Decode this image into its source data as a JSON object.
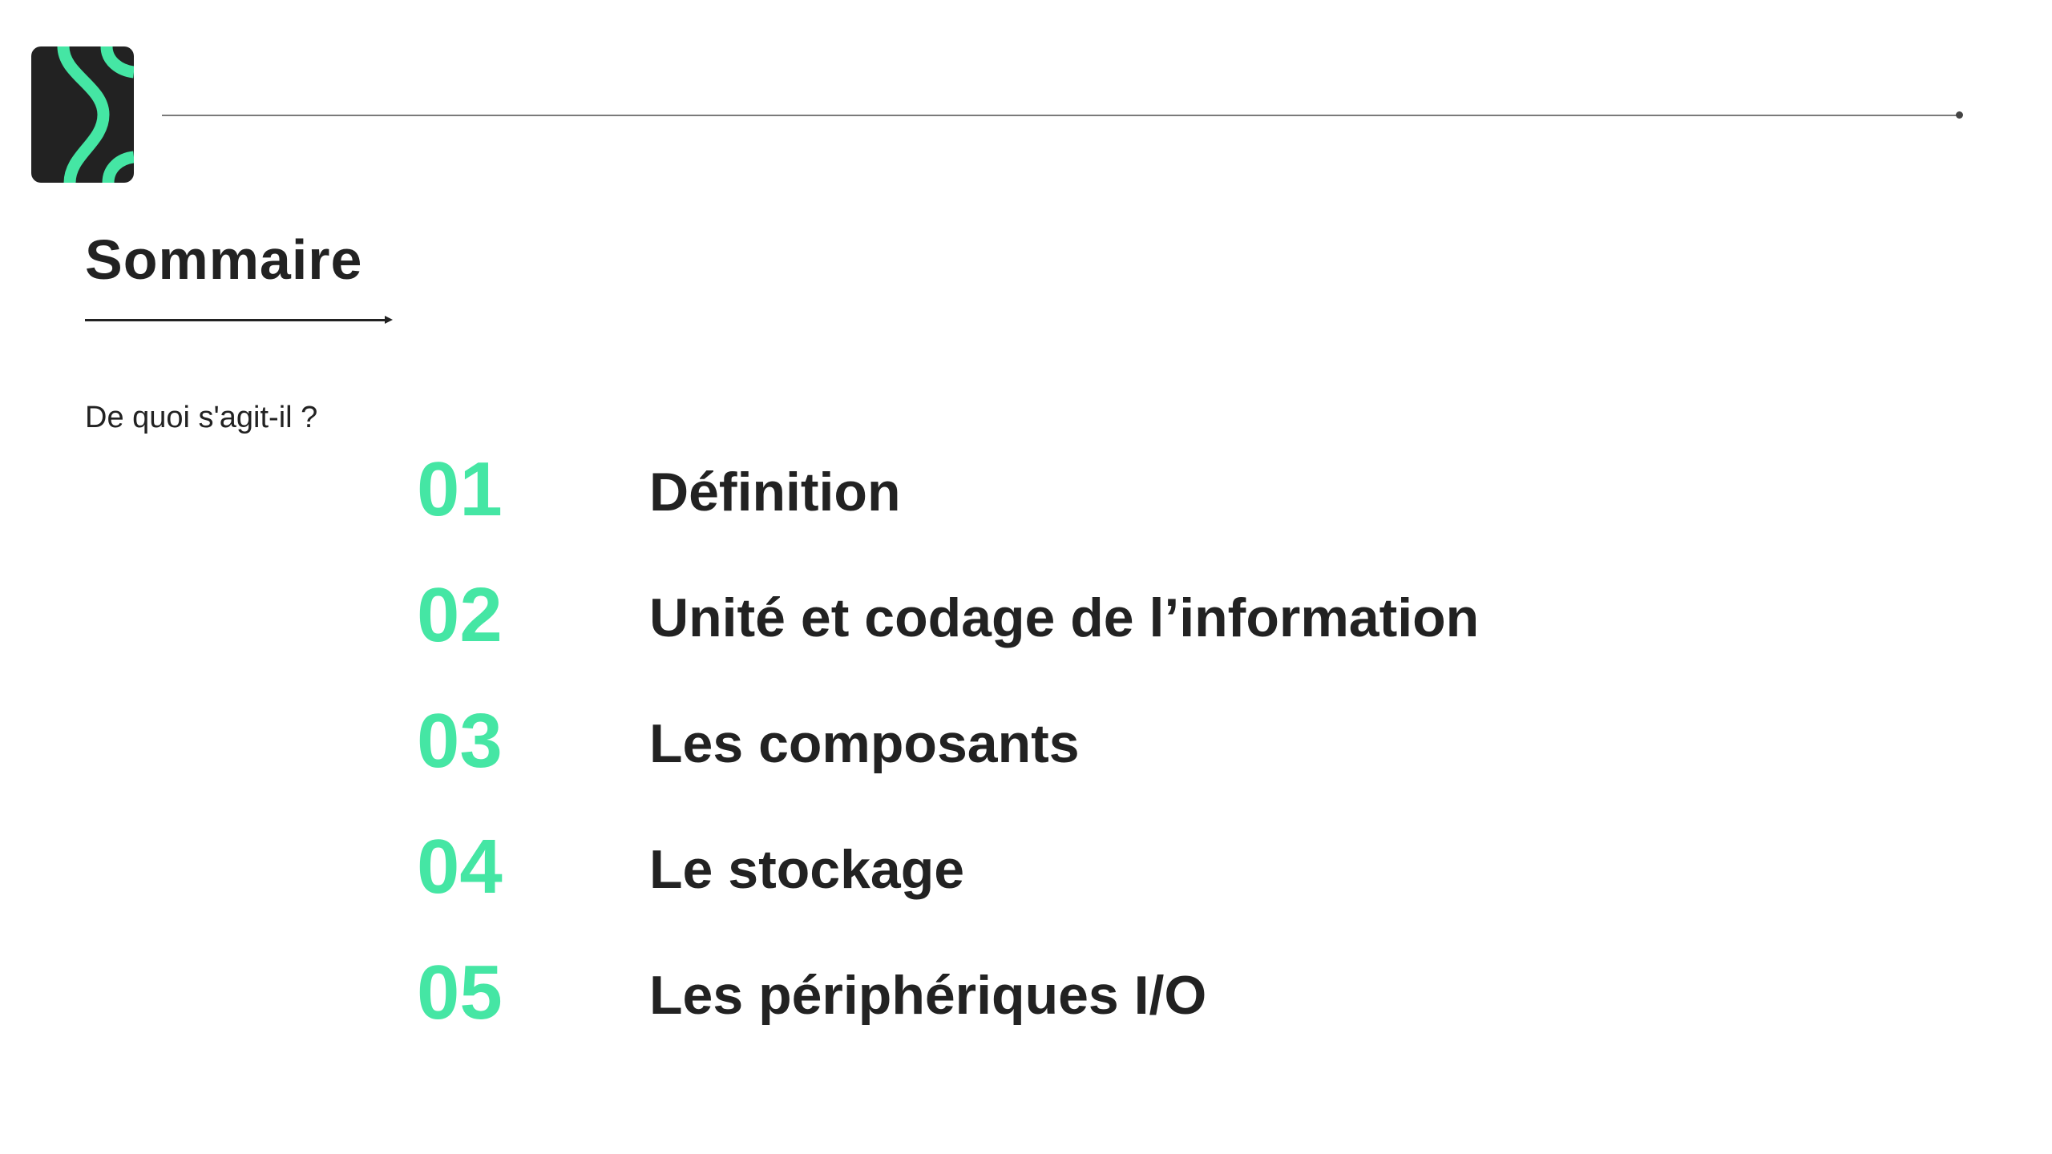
{
  "header": {
    "title": "Sommaire",
    "subtitle": "De quoi s'agit-il ?"
  },
  "colors": {
    "accent": "#45e6a4",
    "text": "#222222",
    "logo_background": "#222222"
  },
  "icons": {
    "logo": "brand-logo-icon"
  },
  "toc": {
    "items": [
      {
        "number": "01",
        "label": "Définition"
      },
      {
        "number": "02",
        "label": "Unité et codage de l’information"
      },
      {
        "number": "03",
        "label": "Les composants"
      },
      {
        "number": "04",
        "label": "Le stockage"
      },
      {
        "number": "05",
        "label": "Les périphériques I/O"
      }
    ]
  }
}
